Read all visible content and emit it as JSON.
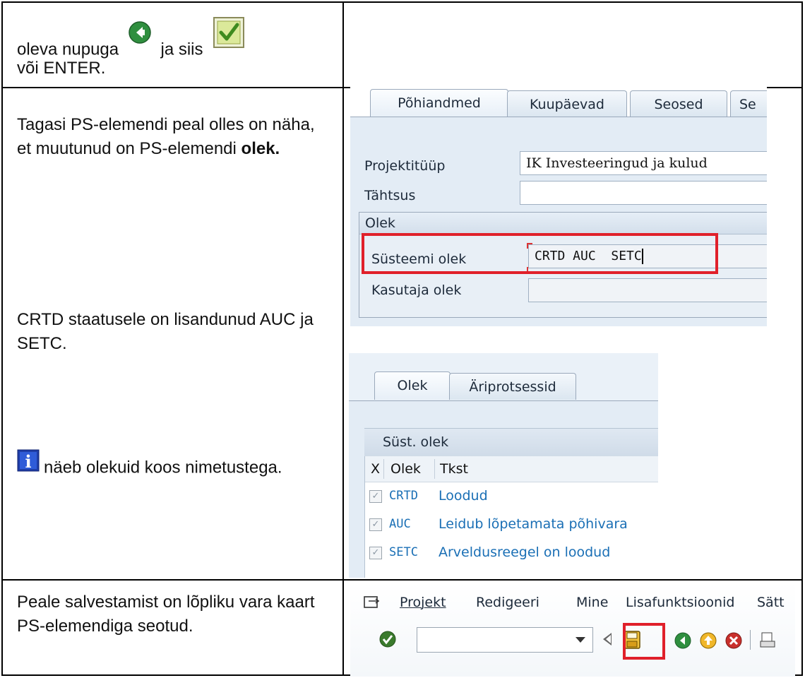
{
  "rows": [
    {
      "text_before": "oleva  nupuga",
      "text_middle": "ja siis",
      "text_after": "või ENTER."
    },
    {
      "p1_before": "Tagasi PS-elemendi peal olles on näha, et muutunud on PS-elemendi ",
      "p1_bold": "olek.",
      "p2": "CRTD staatusele on lisandunud AUC  ja SETC.",
      "p3": "näeb olekuid koos nimetustega."
    },
    {
      "text": "Peale salvestamist on lõpliku vara kaart PS-elemendiga seotud."
    }
  ],
  "shot1": {
    "tabs": [
      "Põhiandmed",
      "Kuupäevad",
      "Seosed",
      "Se"
    ],
    "projektituup_label": "Projektitüüp",
    "projektituup_value": "IK Investeeringud ja kulud",
    "tahtsus_label": "Tähtsus",
    "tahtsus_value": "",
    "group_title": "Olek",
    "systeemi_label": "Süsteemi olek",
    "systeemi_value": "CRTD AUC  SETC",
    "kasutaja_label": "Kasutaja olek",
    "kasutaja_value": "",
    "highlight_color": "#e0202a"
  },
  "shot2": {
    "tabs": [
      "Olek",
      "Äriprotsessid"
    ],
    "section_title": "Süst. olek",
    "headers": [
      "X",
      "Olek",
      "Tkst"
    ],
    "items": [
      {
        "code": "CRTD",
        "text": "Loodud"
      },
      {
        "code": "AUC",
        "text": "Leidub lõpetamata põhivara"
      },
      {
        "code": "SETC",
        "text": "Arveldusreegel on loodud"
      }
    ],
    "link_color": "#1a6fb5"
  },
  "shot3": {
    "menu": [
      "Projekt",
      "Redigeeri",
      "Mine",
      "Lisafunktsioonid",
      "Sätt"
    ],
    "command_value": ""
  }
}
